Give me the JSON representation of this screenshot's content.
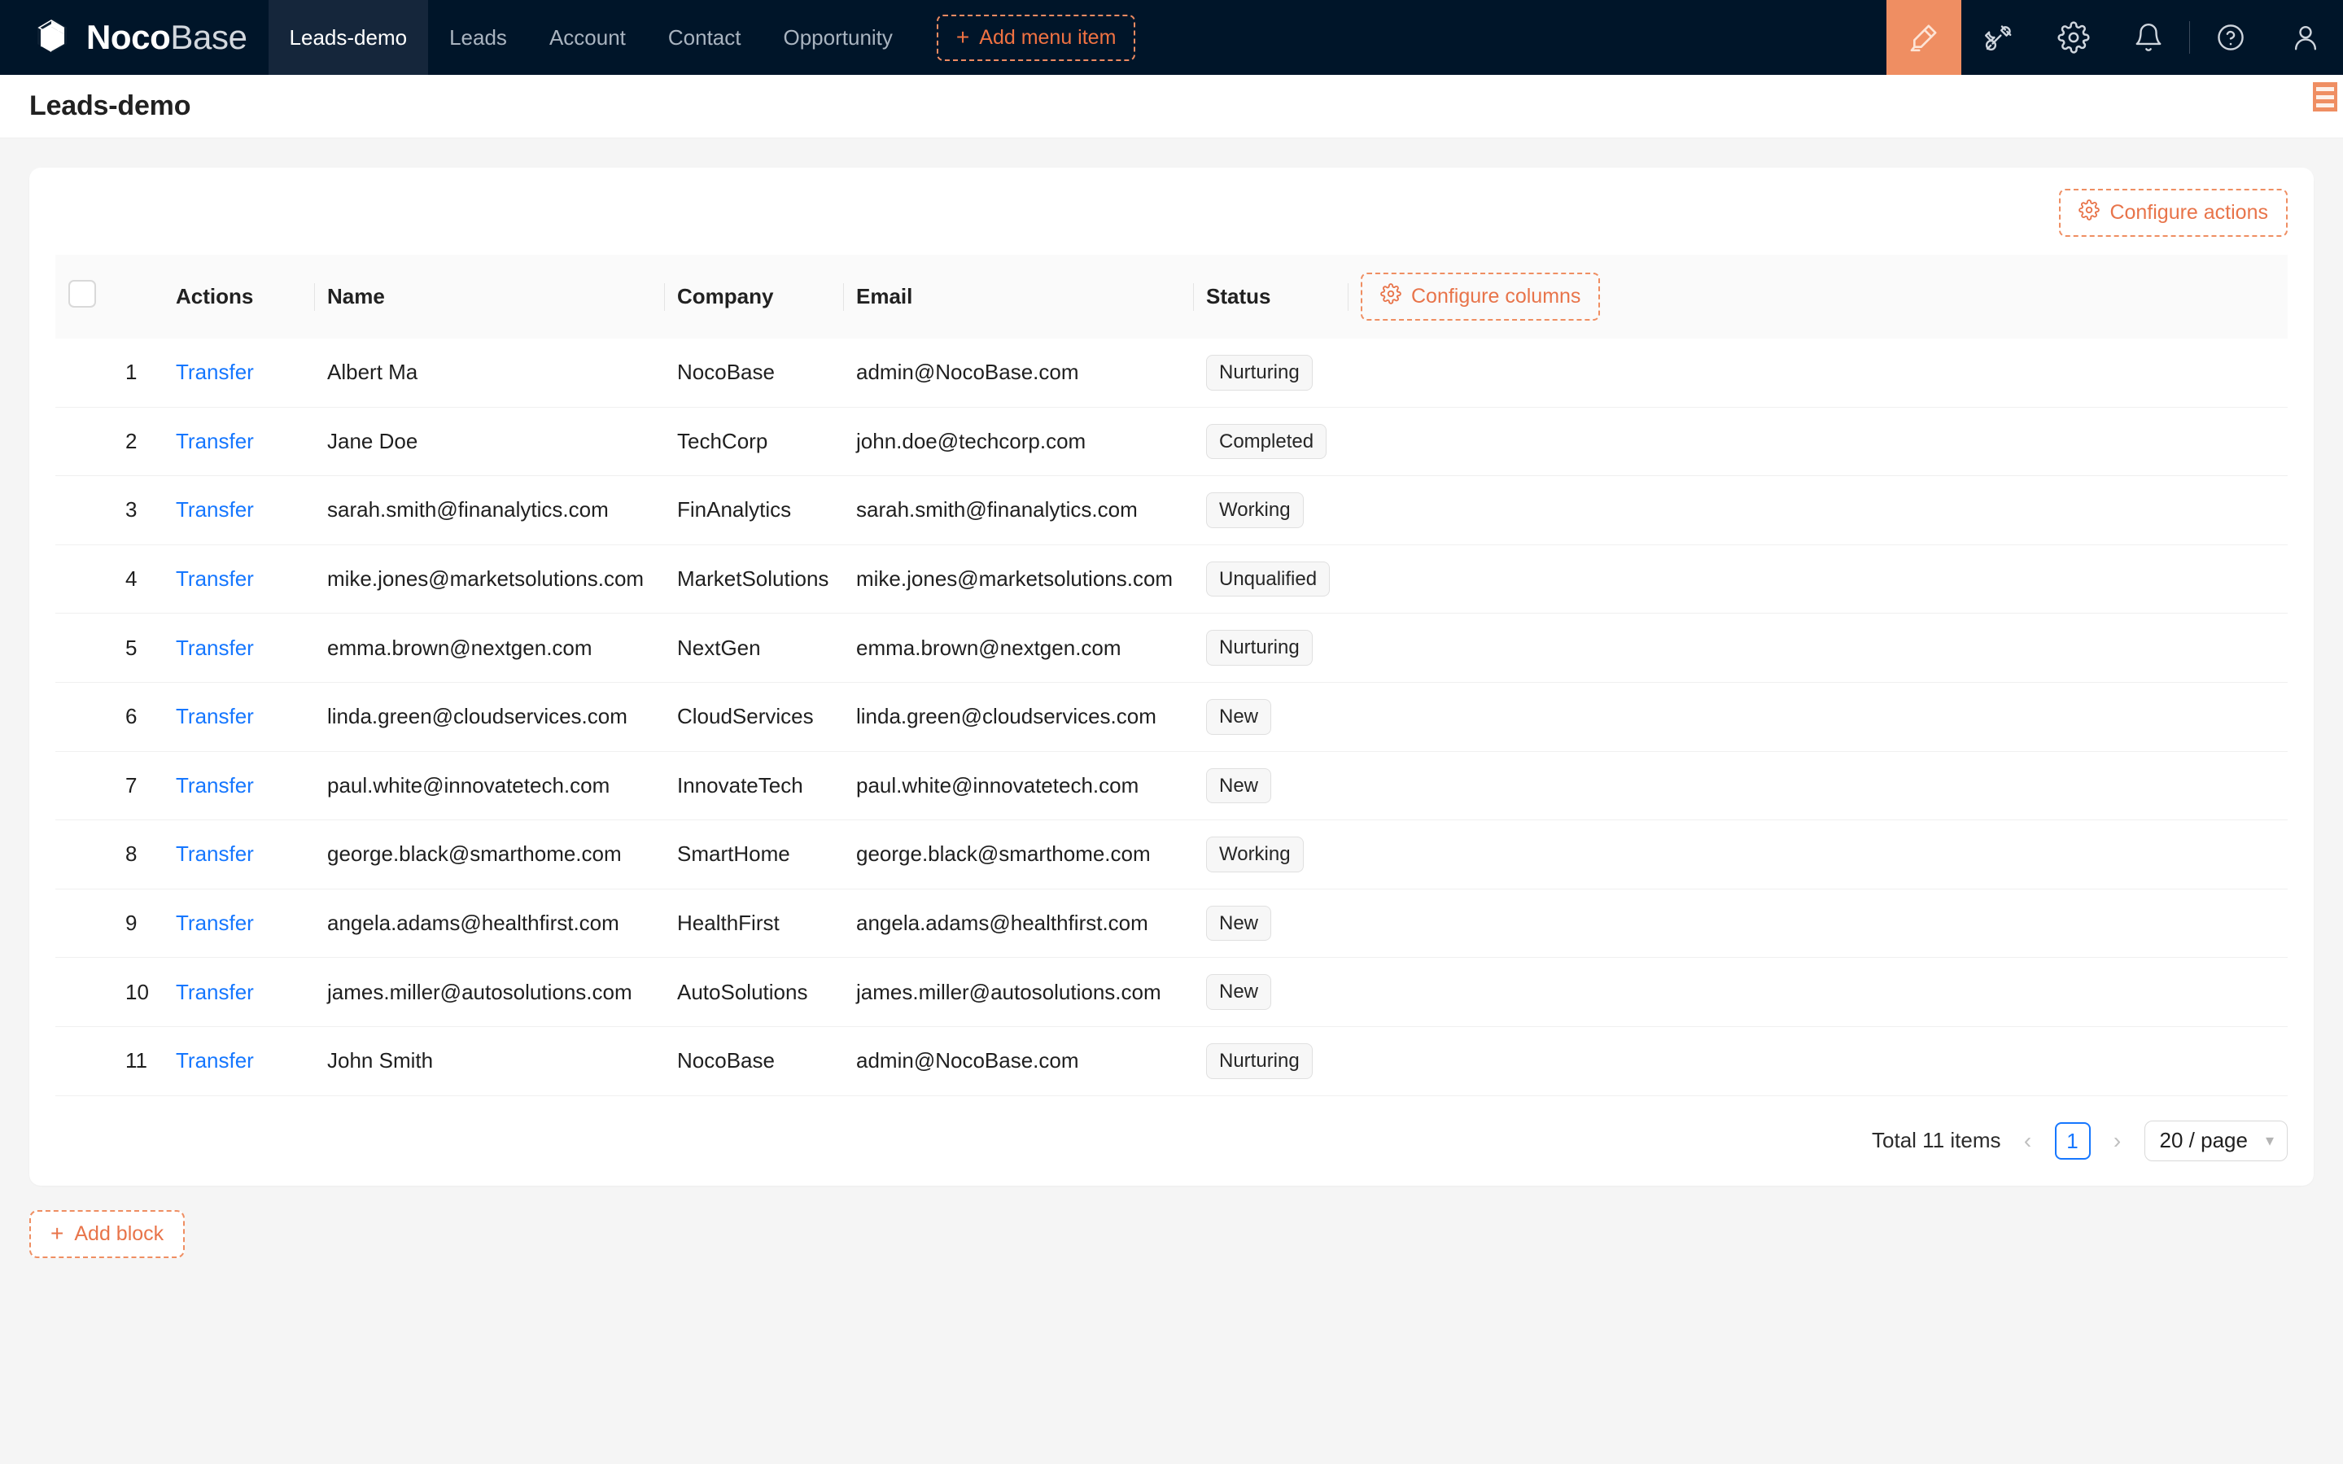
{
  "brand": {
    "part1": "Noco",
    "part2": "Base",
    "logo_icon": "nocobase-cube-logo"
  },
  "nav": {
    "items": [
      {
        "label": "Leads-demo",
        "active": true
      },
      {
        "label": "Leads",
        "active": false
      },
      {
        "label": "Account",
        "active": false
      },
      {
        "label": "Contact",
        "active": false
      },
      {
        "label": "Opportunity",
        "active": false
      }
    ],
    "add_menu_item": {
      "label": "Add menu item",
      "plus": "+"
    },
    "right_icons": [
      {
        "name": "highlighter-icon",
        "active": true
      },
      {
        "name": "plugin-icon",
        "active": false
      },
      {
        "name": "gear-icon",
        "active": false
      },
      {
        "name": "bell-icon",
        "active": false
      },
      {
        "name": "help-icon",
        "active": false
      },
      {
        "name": "user-avatar-icon",
        "active": false
      }
    ]
  },
  "page": {
    "title": "Leads-demo",
    "hamburger_icon": "hamburger-menu-icon"
  },
  "toolbar": {
    "configure_actions_label": "Configure actions",
    "configure_columns_label": "Configure columns",
    "gear_icon": "gear-icon"
  },
  "table": {
    "columns": [
      "Actions",
      "Name",
      "Company",
      "Email",
      "Status"
    ],
    "rows": [
      {
        "idx": "1",
        "action": "Transfer",
        "name": "Albert Ma",
        "company": "NocoBase",
        "email": "admin@NocoBase.com",
        "status": "Nurturing"
      },
      {
        "idx": "2",
        "action": "Transfer",
        "name": "Jane Doe",
        "company": "TechCorp",
        "email": "john.doe@techcorp.com",
        "status": "Completed"
      },
      {
        "idx": "3",
        "action": "Transfer",
        "name": "sarah.smith@finanalytics.com",
        "company": "FinAnalytics",
        "email": "sarah.smith@finanalytics.com",
        "status": "Working"
      },
      {
        "idx": "4",
        "action": "Transfer",
        "name": "mike.jones@marketsolutions.com",
        "company": "MarketSolutions",
        "email": "mike.jones@marketsolutions.com",
        "status": "Unqualified"
      },
      {
        "idx": "5",
        "action": "Transfer",
        "name": "emma.brown@nextgen.com",
        "company": "NextGen",
        "email": "emma.brown@nextgen.com",
        "status": "Nurturing"
      },
      {
        "idx": "6",
        "action": "Transfer",
        "name": "linda.green@cloudservices.com",
        "company": "CloudServices",
        "email": "linda.green@cloudservices.com",
        "status": "New"
      },
      {
        "idx": "7",
        "action": "Transfer",
        "name": "paul.white@innovatetech.com",
        "company": "InnovateTech",
        "email": "paul.white@innovatetech.com",
        "status": "New"
      },
      {
        "idx": "8",
        "action": "Transfer",
        "name": "george.black@smarthome.com",
        "company": "SmartHome",
        "email": "george.black@smarthome.com",
        "status": "Working"
      },
      {
        "idx": "9",
        "action": "Transfer",
        "name": "angela.adams@healthfirst.com",
        "company": "HealthFirst",
        "email": "angela.adams@healthfirst.com",
        "status": "New"
      },
      {
        "idx": "10",
        "action": "Transfer",
        "name": "james.miller@autosolutions.com",
        "company": "AutoSolutions",
        "email": "james.miller@autosolutions.com",
        "status": "New"
      },
      {
        "idx": "11",
        "action": "Transfer",
        "name": "John Smith",
        "company": "NocoBase",
        "email": "admin@NocoBase.com",
        "status": "Nurturing"
      }
    ]
  },
  "pagination": {
    "total_label": "Total 11 items",
    "prev_icon": "chevron-left-icon",
    "current_page": "1",
    "next_icon": "chevron-right-icon",
    "page_size": "20 / page",
    "caret_icon": "chevron-down-icon"
  },
  "footer": {
    "add_block_label": "Add block",
    "plus": "+"
  },
  "colors": {
    "nav_bg": "#001529",
    "accent_orange": "#ef8e62",
    "accent_orange_text": "#e8744a",
    "link_blue": "#1677ff",
    "page_bg": "#f5f5f5"
  }
}
